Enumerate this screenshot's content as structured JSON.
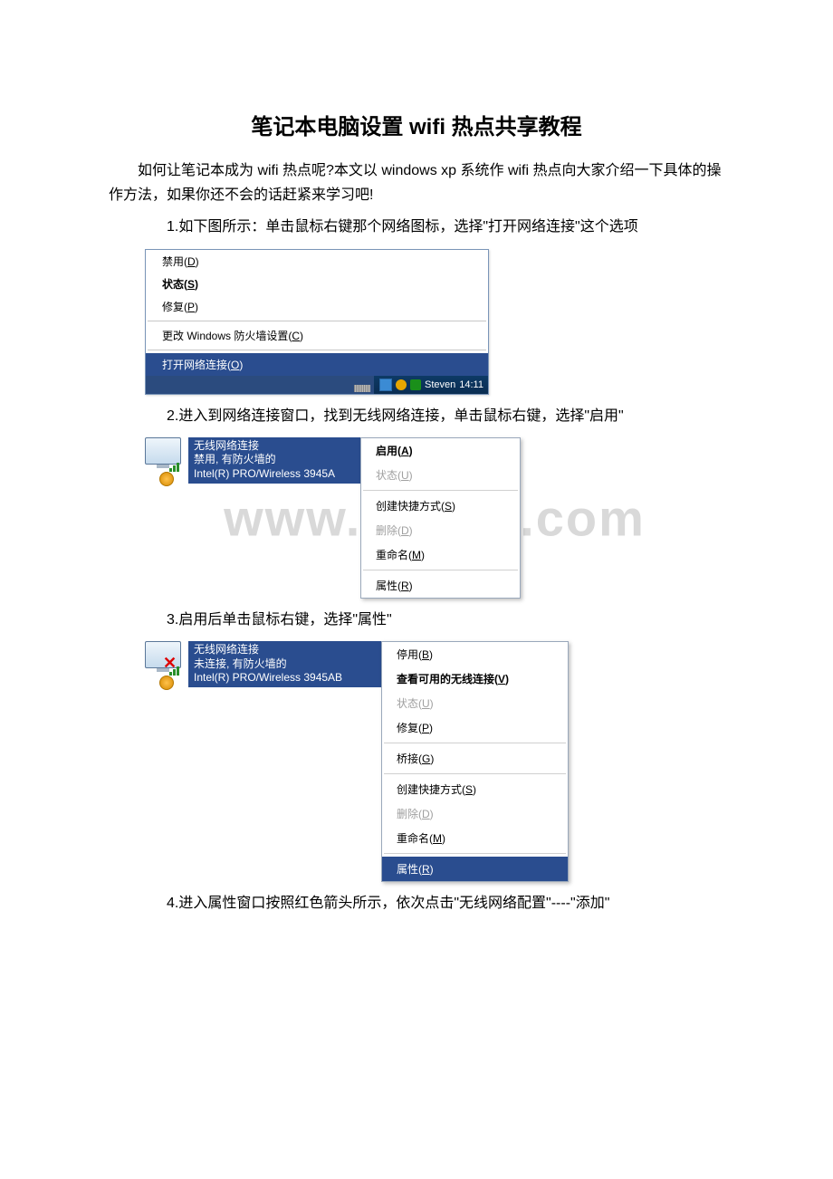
{
  "title": "笔记本电脑设置 wifi 热点共享教程",
  "intro": "如何让笔记本成为 wifi 热点呢?本文以 windows xp 系统作 wifi 热点向大家介绍一下具体的操作方法，如果你还不会的话赶紧来学习吧!",
  "steps": {
    "s1": "1.如下图所示：单击鼠标右键那个网络图标，选择\"打开网络连接\"这个选项",
    "s2": "2.进入到网络连接窗口，找到无线网络连接，单击鼠标右键，选择\"启用\"",
    "s3": "3.启用后单击鼠标右键，选择\"属性\"",
    "s4": "4.进入属性窗口按照红色箭头所示，依次点击\"无线网络配置\"----\"添加\""
  },
  "fig1": {
    "menu": {
      "disable": {
        "t": "禁用(",
        "u": "D",
        "a": ")"
      },
      "status": {
        "t": "状态(",
        "u": "S",
        "a": ")"
      },
      "repair": {
        "t": "修复(",
        "u": "P",
        "a": ")"
      },
      "firewall": {
        "t": "更改 Windows 防火墙设置(",
        "u": "C",
        "a": ")"
      },
      "open": {
        "t": "打开网络连接(",
        "u": "O",
        "a": ")"
      }
    },
    "tray": {
      "user": "Steven",
      "time": "14:11"
    }
  },
  "fig2": {
    "conn": {
      "title": "无线网络连接",
      "status": "禁用, 有防火墙的",
      "nic": "Intel(R) PRO/Wireless 3945A"
    },
    "menu": {
      "enable": {
        "t": "启用(",
        "u": "A",
        "a": ")"
      },
      "status": {
        "t": "状态(",
        "u": "U",
        "a": ")"
      },
      "shortcut": {
        "t": "创建快捷方式(",
        "u": "S",
        "a": ")"
      },
      "delete": {
        "t": "删除(",
        "u": "D",
        "a": ")"
      },
      "rename": {
        "t": "重命名(",
        "u": "M",
        "a": ")"
      },
      "props": {
        "t": "属性(",
        "u": "R",
        "a": ")"
      }
    }
  },
  "fig3": {
    "conn": {
      "title": "无线网络连接",
      "status": "未连接, 有防火墙的",
      "nic": "Intel(R) PRO/Wireless 3945AB"
    },
    "menu": {
      "disable": {
        "t": "停用(",
        "u": "B",
        "a": ")"
      },
      "view": {
        "t": "查看可用的无线连接(",
        "u": "V",
        "a": ")"
      },
      "status": {
        "t": "状态(",
        "u": "U",
        "a": ")"
      },
      "repair": {
        "t": "修复(",
        "u": "P",
        "a": ")"
      },
      "bridge": {
        "t": "桥接(",
        "u": "G",
        "a": ")"
      },
      "shortcut": {
        "t": "创建快捷方式(",
        "u": "S",
        "a": ")"
      },
      "delete": {
        "t": "删除(",
        "u": "D",
        "a": ")"
      },
      "rename": {
        "t": "重命名(",
        "u": "M",
        "a": ")"
      },
      "props": {
        "t": "属性(",
        "u": "R",
        "a": ")"
      }
    }
  },
  "watermark": "www.bdocx.com"
}
